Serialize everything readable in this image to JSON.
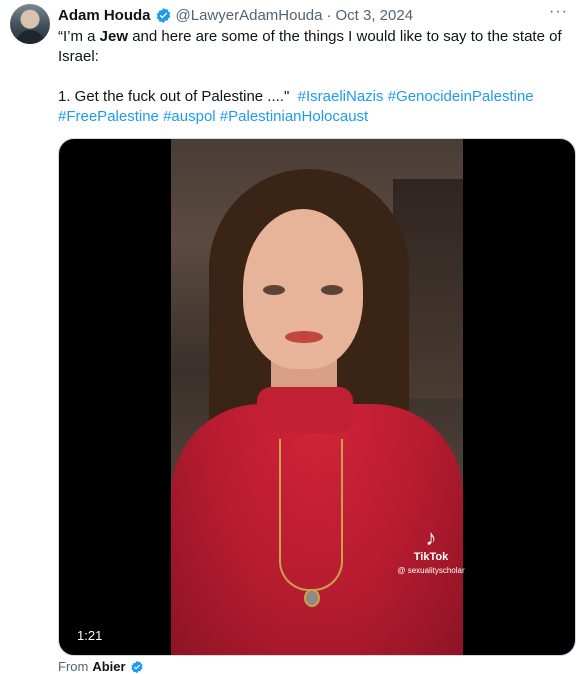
{
  "tweet": {
    "author_name": "Adam Houda",
    "handle": "@LawyerAdamHouda",
    "separator": "·",
    "date": "Oct 3, 2024",
    "more_label": "···",
    "text_line1_a": "“I’m a ",
    "text_line1_bold": "Jew",
    "text_line1_b": " and here are some of the things I would like to say to the state of",
    "text_line2": "Israel:",
    "text_line3": "1. Get the fuck out of Palestine ....\"",
    "hashtags": [
      "#IsraeliNazis",
      "#GenocideinPalestine",
      "#FreePalestine",
      "#auspol",
      "#PalestinianHolocaust"
    ]
  },
  "media": {
    "duration": "1:21",
    "watermark_brand": "TikTok",
    "watermark_user": "@ sexualityscholar"
  },
  "footer": {
    "from_label": "From",
    "app_name": "Abier"
  },
  "colors": {
    "link": "#1d9bf0",
    "verified": "#1d9bf0",
    "text_secondary": "#536471"
  }
}
